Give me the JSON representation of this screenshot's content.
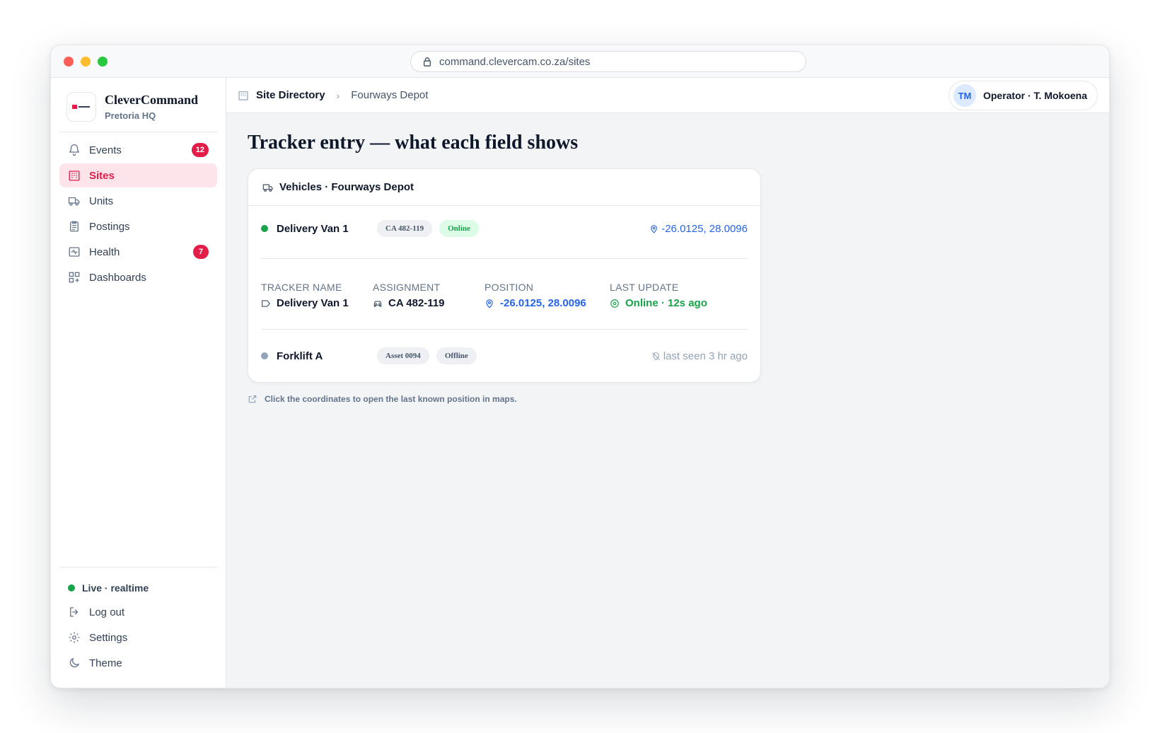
{
  "browser": {
    "url": "command.clevercam.co.za/sites"
  },
  "brand": {
    "name": "CleverCommand",
    "subtitle": "Pretoria HQ"
  },
  "nav": [
    {
      "label": "Events",
      "icon": "bell-icon",
      "badge": "12"
    },
    {
      "label": "Sites",
      "icon": "building-icon",
      "active": true
    },
    {
      "label": "Units",
      "icon": "truck-icon"
    },
    {
      "label": "Postings",
      "icon": "clipboard-icon"
    },
    {
      "label": "Health",
      "icon": "activity-icon",
      "badge": "7"
    },
    {
      "label": "Dashboards",
      "icon": "grid-icon"
    }
  ],
  "sidebar_bottom": {
    "live": "Live · realtime",
    "logout": "Log out",
    "settings": "Settings",
    "theme": "Theme"
  },
  "breadcrumb": {
    "root": "Site Directory",
    "current": "Fourways Depot"
  },
  "operator": {
    "initials": "TM",
    "label": "Operator · T. Mokoena"
  },
  "page_title": "Tracker entry — what each field shows",
  "card": {
    "title": "Vehicles · Fourways Depot",
    "row1": {
      "name": "Delivery Van 1",
      "plate": "CA 482-119",
      "status": "Online",
      "coords": "-26.0125, 28.0096"
    },
    "details": {
      "tracker_label": "TRACKER NAME",
      "tracker_value": "Delivery Van 1",
      "assignment_label": "ASSIGNMENT",
      "assignment_value": "CA 482-119",
      "position_label": "POSITION",
      "position_value": "-26.0125, 28.0096",
      "update_label": "LAST UPDATE",
      "update_value": "Online · 12s ago"
    },
    "row2": {
      "name": "Forklift A",
      "asset": "Asset 0094",
      "status": "Offline",
      "last_seen": "last seen 3 hr ago"
    }
  },
  "hint": "Click the coordinates to open the last known position in maps.",
  "colors": {
    "accent": "#e11d48",
    "online": "#16a34a",
    "link": "#2563eb",
    "offline": "#94a3b8"
  }
}
